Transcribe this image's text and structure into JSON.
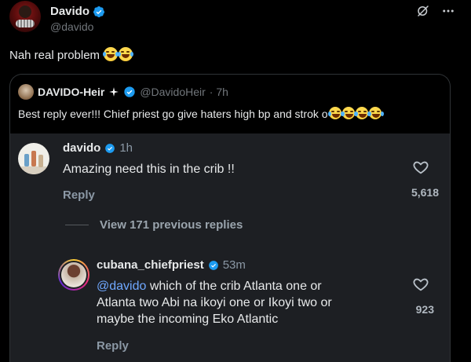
{
  "post": {
    "author_name": "Davido",
    "author_handle": "@davido",
    "text": "Nah real problem",
    "emoji_count": 2
  },
  "quote": {
    "author_name": "DAVIDO-Heir",
    "author_handle": "@DavidoHeir",
    "time": "· 7h",
    "text": "Best reply ever!!! Chief priest go give haters high bp and strok o",
    "emoji_count": 4
  },
  "comments": [
    {
      "username": "davido",
      "time": "1h",
      "text": "Amazing need this in the crib !!",
      "reply_label": "Reply",
      "likes": "5,618"
    },
    {
      "username": "cubana_chiefpriest",
      "time": "53m",
      "mention": "@davido",
      "text_line1": " which of the crib Atlanta one or",
      "text_line2": "Atlanta two Abi na ikoyi one or Ikoyi two or",
      "text_line3": "maybe the incoming Eko Atlantic",
      "reply_label": "Reply",
      "likes": "923"
    }
  ],
  "view_previous_label": "View 171 previous replies",
  "colors": {
    "verified": "#1d9bf0",
    "mention": "#6fa8ff",
    "background": "#000000",
    "card": "#1d1f23"
  },
  "icons": [
    "verified-badge-icon",
    "grok-icon",
    "more-icon",
    "sparkle-icon",
    "heart-icon"
  ]
}
